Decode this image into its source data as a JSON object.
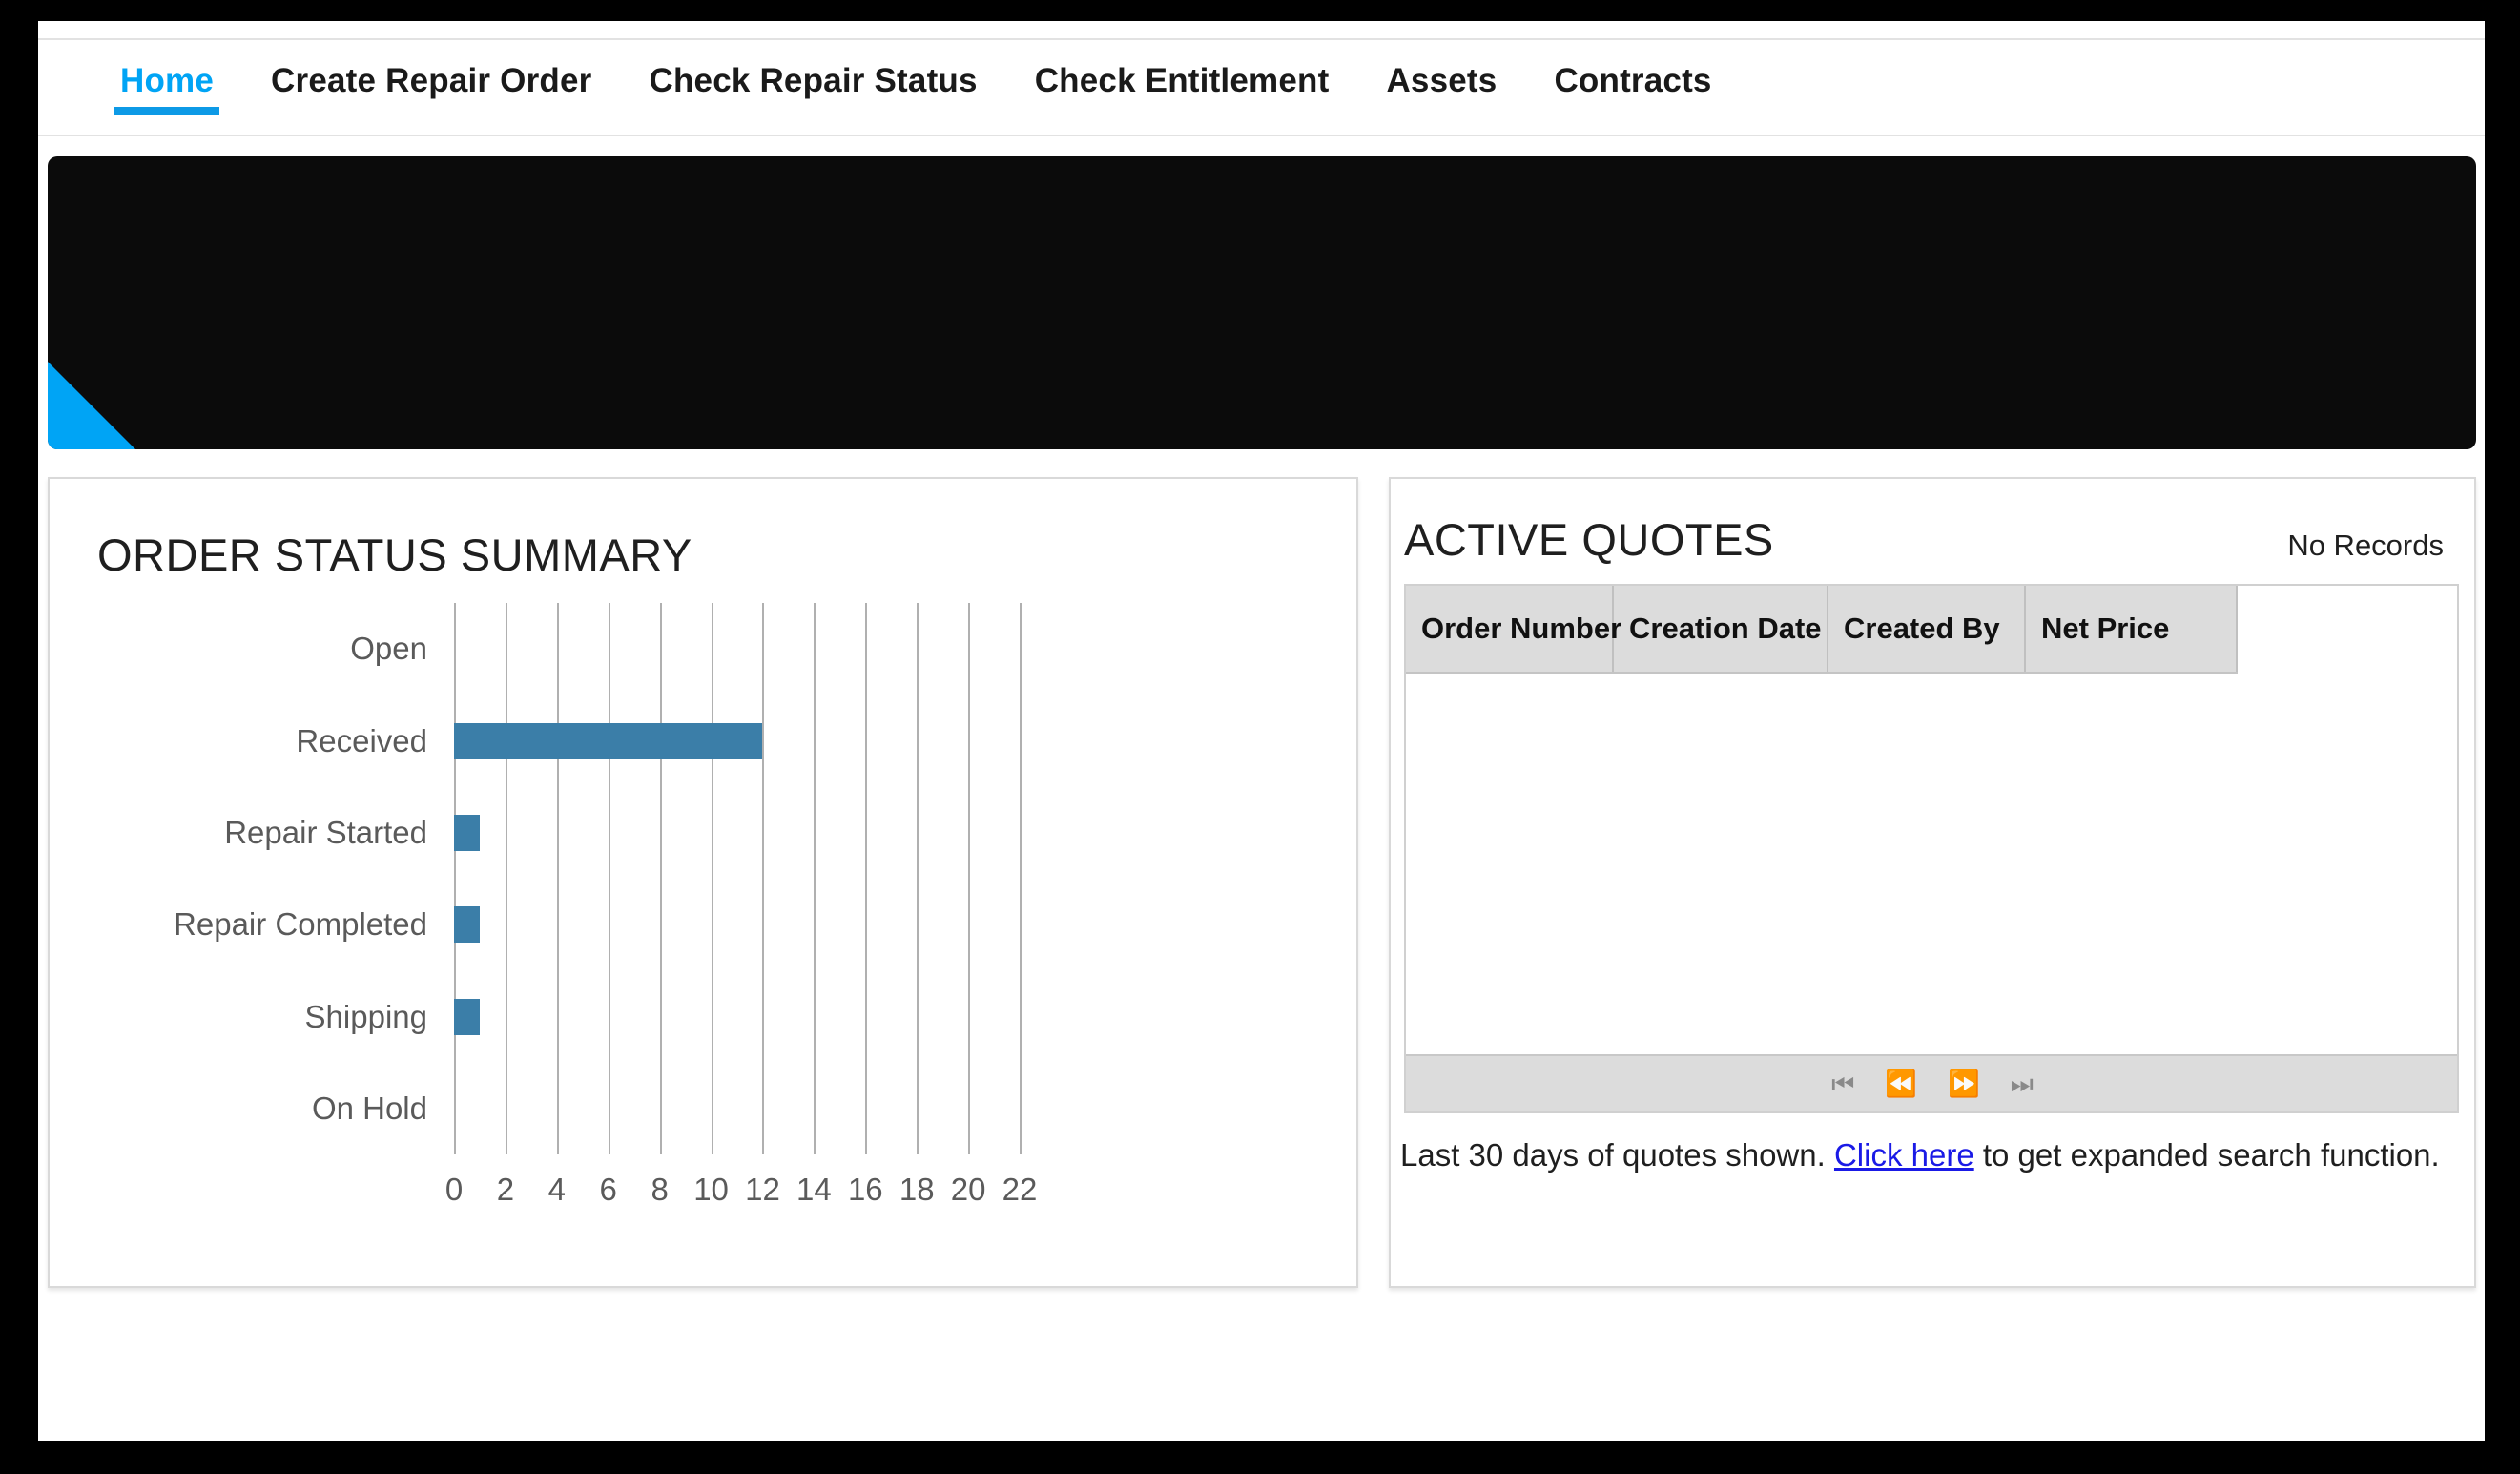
{
  "nav": {
    "items": [
      {
        "label": "Home",
        "active": true
      },
      {
        "label": "Create Repair Order",
        "active": false
      },
      {
        "label": "Check Repair Status",
        "active": false
      },
      {
        "label": "Check Entitlement",
        "active": false
      },
      {
        "label": "Assets",
        "active": false
      },
      {
        "label": "Contracts",
        "active": false
      }
    ]
  },
  "hero": {
    "background_color": "#0b0b0b",
    "accent_color": "#00a4f5"
  },
  "order_status_panel": {
    "title": "ORDER STATUS SUMMARY"
  },
  "active_quotes_panel": {
    "title": "ACTIVE QUOTES",
    "status": "No Records",
    "columns": [
      "Order Number",
      "Creation Date",
      "Created By",
      "Net Price"
    ],
    "rows": [],
    "pager": {
      "first_label": "⏮",
      "previous_label": "⏪",
      "next_label": "⏩",
      "last_label": "⏭"
    },
    "footnote_prefix": "Last 30 days of quotes shown. ",
    "footnote_link": "Click here",
    "footnote_suffix": " to get expanded search function."
  },
  "chart_data": {
    "type": "bar",
    "orientation": "horizontal",
    "title": "ORDER STATUS SUMMARY",
    "categories": [
      "Open",
      "Received",
      "Repair Started",
      "Repair Completed",
      "Shipping",
      "On Hold"
    ],
    "values": [
      0,
      12,
      1,
      1,
      1,
      0
    ],
    "xlabel": "",
    "ylabel": "",
    "xlim": [
      0,
      23
    ],
    "xticks": [
      0,
      2,
      4,
      6,
      8,
      10,
      12,
      14,
      16,
      18,
      20,
      22
    ],
    "grid": true,
    "legend": false,
    "bar_color": "#3b7ea8",
    "gridline_color": "#b0b0b0",
    "label_color": "#5a5a5a"
  }
}
